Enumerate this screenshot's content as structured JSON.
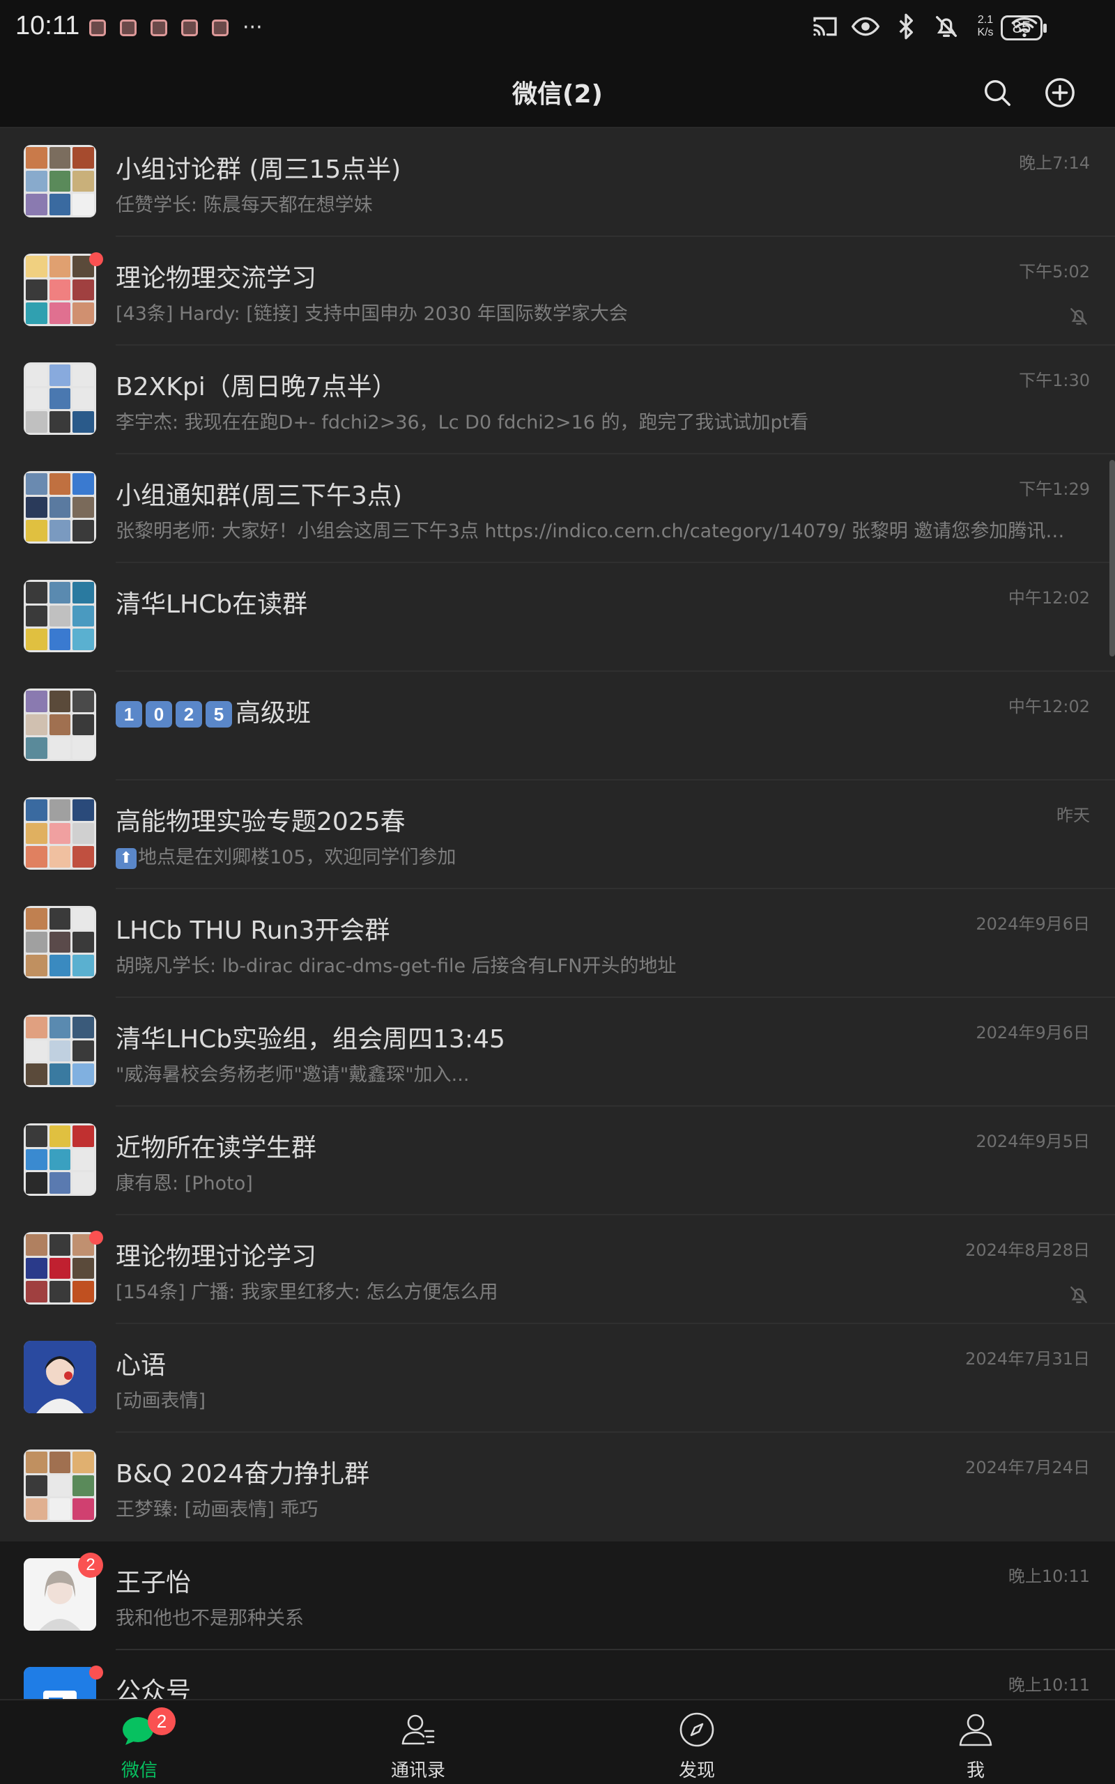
{
  "status_bar": {
    "time": "10:11",
    "more": "···",
    "net_speed_value": "2.1",
    "net_speed_unit": "K/s",
    "battery": "85"
  },
  "header": {
    "title": "微信(2)"
  },
  "chats": [
    {
      "name": "小组讨论群 (周三15点半)",
      "message": "任赞学长: 陈晨每天都在想学妹",
      "time": "晚上7:14"
    },
    {
      "name": "理论物理交流学习",
      "message": "[43条] Hardy: [链接] 支持中国申办 2030 年国际数学家大会",
      "time": "下午5:02"
    },
    {
      "name": "B2XKpi（周日晚7点半）",
      "message": "李宇杰: 我现在在跑D+- fdchi2>36，Lc D0 fdchi2>16 的，跑完了我试试加pt看",
      "time": "下午1:30"
    },
    {
      "name": "小组通知群(周三下午3点)",
      "message": "张黎明老师: 大家好！小组会这周三下午3点 https://indico.cern.ch/category/14079/ 张黎明 邀请您参加腾讯会议...",
      "time": "下午1:29"
    },
    {
      "name": "清华LHCb在读群",
      "message": "",
      "time": "中午12:02"
    },
    {
      "name": "高级班",
      "name_digits": [
        "1",
        "0",
        "2",
        "5"
      ],
      "message": "",
      "time": "中午12:02"
    },
    {
      "name": "高能物理实验专题2025春",
      "message": "地点是在刘卿楼105，欢迎同学们参加",
      "time": "昨天"
    },
    {
      "name": "LHCb THU Run3开会群",
      "message": "胡晓凡学长: lb-dirac dirac-dms-get-file 后接含有LFN开头的地址",
      "time": "2024年9月6日"
    },
    {
      "name": "清华LHCb实验组，组会周四13:45",
      "message": "\"威海暑校会务杨老师\"邀请\"戴鑫琛\"加入...",
      "time": "2024年9月6日"
    },
    {
      "name": "近物所在读学生群",
      "message": "康有恩: [Photo]",
      "time": "2024年9月5日"
    },
    {
      "name": "理论物理讨论学习",
      "message": "[154条] 广播:   我家里红移大: 怎么方便怎么用",
      "time": "2024年8月28日"
    },
    {
      "name": "心语",
      "message": "[动画表情]",
      "time": "2024年7月31日"
    },
    {
      "name": "B&Q 2024奋力挣扎群",
      "message": "王梦臻: [动画表情] 乖巧",
      "time": "2024年7月24日"
    },
    {
      "name": "王子怡",
      "message": "我和他也不是那种关系",
      "time": "晚上10:11",
      "badge": "2"
    },
    {
      "name": "公众号",
      "message": "",
      "time": "晚上10:11"
    }
  ],
  "tabs": [
    {
      "label": "微信",
      "badge": "2"
    },
    {
      "label": "通讯录"
    },
    {
      "label": "发现"
    },
    {
      "label": "我"
    }
  ],
  "colors": {
    "accent": "#07c160",
    "badge": "#fa5151"
  }
}
